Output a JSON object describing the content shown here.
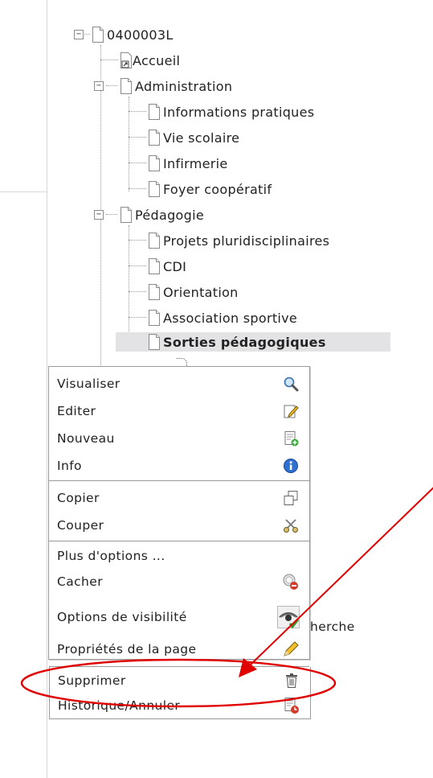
{
  "tree": {
    "root": "0400003L",
    "accueil": "Accueil",
    "administration": "Administration",
    "admin_children": [
      "Informations pratiques",
      "Vie scolaire",
      "Infirmerie",
      "Foyer coopératif"
    ],
    "pedagogie": "Pédagogie",
    "peda_children": [
      "Projets pluridisciplinaires",
      "CDI",
      "Orientation",
      "Association sportive"
    ],
    "selected": "Sorties pédagogiques"
  },
  "context_menu": {
    "items": [
      {
        "label": "Visualiser",
        "icon": "magnifier-icon"
      },
      {
        "label": "Editer",
        "icon": "edit-page-icon"
      },
      {
        "label": "Nouveau",
        "icon": "new-page-icon"
      },
      {
        "label": "Info",
        "icon": "info-icon"
      },
      {
        "label": "Copier",
        "icon": "copy-icon"
      },
      {
        "label": "Couper",
        "icon": "scissors-icon"
      },
      {
        "label": "Plus d'options ...",
        "icon": ""
      },
      {
        "label": "Cacher",
        "icon": "hide-icon"
      },
      {
        "label": "Options de visibilité",
        "icon": "eye-icon"
      },
      {
        "label": "Propriétés de la page",
        "icon": "pencil-icon"
      },
      {
        "label": "Supprimer",
        "icon": "trash-icon"
      },
      {
        "label": "Historique/Annuler",
        "icon": "history-icon"
      }
    ]
  },
  "behind_text": "herche",
  "annotation": {
    "arrow_color": "#e00000",
    "ellipse_color": "#e00000"
  }
}
